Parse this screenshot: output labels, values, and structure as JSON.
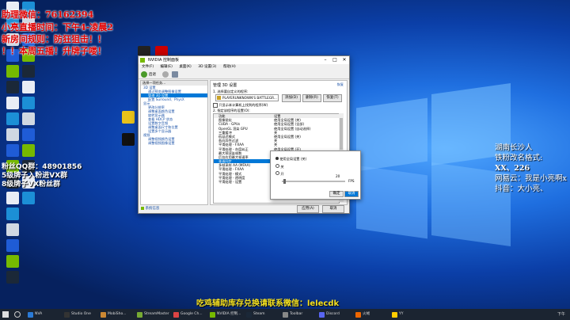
{
  "overlay": {
    "left_red_lines": [
      "助理微信：76162394",
      "小亮直播时间：下午4-凌晨2",
      "新房间规则：防狂狙击！！",
      "！！本周五播！升牌子喽！"
    ],
    "left_white_lines": [
      "粉丝QQ群：48901856",
      "5级牌子入粉进VX群",
      "8级牌子VX粉丝群"
    ],
    "right_lines": [
      "湖南长沙人",
      "铁粉改名格式:",
      "XX、226",
      "网易云：我是小亮啊x",
      "抖音：大小亮、"
    ],
    "bottom_yellow": "吃鸡辅助库存兑换请联系微信：lelecdk"
  },
  "window": {
    "title": "NVIDIA 控制面板",
    "menu": [
      "文件(F)",
      "编辑(E)",
      "桌面(K)",
      "3D 设置(3)",
      "帮助(H)"
    ],
    "left_header": "选择一项任务...",
    "tree": [
      {
        "label": "3D 设置",
        "level": 0,
        "selected": false
      },
      {
        "label": "通过预览调整图像设置",
        "level": 1,
        "selected": false
      },
      {
        "label": "管理 3D 设置",
        "level": 1,
        "selected": true
      },
      {
        "label": "配置 Surround、PhysX",
        "level": 1,
        "selected": false
      },
      {
        "label": "显示",
        "level": 0,
        "selected": false
      },
      {
        "label": "更改分辨率",
        "level": 1,
        "selected": false
      },
      {
        "label": "调整桌面颜色设置",
        "level": 1,
        "selected": false
      },
      {
        "label": "旋转显示器",
        "level": 1,
        "selected": false
      },
      {
        "label": "查看 HDCP 状态",
        "level": 1,
        "selected": false
      },
      {
        "label": "设置数字音频",
        "level": 1,
        "selected": false
      },
      {
        "label": "调整桌面尺寸和位置",
        "level": 1,
        "selected": false
      },
      {
        "label": "设置多个显示器",
        "level": 1,
        "selected": false
      },
      {
        "label": "视频",
        "level": 0,
        "selected": false
      },
      {
        "label": "调整视频颜色设置",
        "level": 1,
        "selected": false
      },
      {
        "label": "调整视频图像设置",
        "level": 1,
        "selected": false
      }
    ],
    "right_title": "管理 3D 设置",
    "restore_label": "恢复",
    "section1": "1. 选择要自定义的程序:",
    "program_value": "PLAYERUNKNOWN'S BATTLEGR...",
    "add_btn": "添加(D)",
    "remove_btn": "删除(R)",
    "restore_btn": "恢复(T)",
    "checkbox_label": "只显示本计算机上找到的程序(W)",
    "section2": "2. 指定该程序的设置(O):",
    "col_feature": "功能",
    "col_setting": "设置",
    "settings": [
      {
        "feature": "图像锐化",
        "value": "使用全局设置 (关)"
      },
      {
        "feature": "CUDA - GPUs",
        "value": "使用全局设置 (全部)"
      },
      {
        "feature": "OpenGL 渲染 GPU",
        "value": "使用全局设置 (自动选择)"
      },
      {
        "feature": "三重缓冲",
        "value": "关"
      },
      {
        "feature": "低延迟模式",
        "value": "使用全局设置 (关)"
      },
      {
        "feature": "各向异性过滤",
        "value": "关"
      },
      {
        "feature": "平滑处理 - FXAA",
        "value": "关"
      },
      {
        "feature": "平滑处理 - 灰度纠正",
        "value": "使用全局设置 (开)"
      },
      {
        "feature": "最大预渲染帧数",
        "value": "使用全局设置 (开)"
      },
      {
        "feature": "后台应用最大帧速率",
        "value": "使用全局设置 (关)"
      },
      {
        "feature": "垂直同步",
        "value": "使用全局设置 (关)"
      },
      {
        "feature": "多帧采样 AA (MFAA)",
        "value": "使用全局设置 (关)"
      },
      {
        "feature": "平滑处理 - FXAA",
        "value": "关"
      },
      {
        "feature": "平滑处理 - 模式",
        "value": "使用全局设置 (应用程序控制)"
      },
      {
        "feature": "平滑处理 - 透明度",
        "value": "使用全局设置 (关)"
      },
      {
        "feature": "平滑处理 - 设置",
        "value": "使用全局设置 (应用程序控制)"
      }
    ],
    "selected_row": 10,
    "sysinfo": "系统信息",
    "apply_btn": "应用(A)",
    "cancel_btn": "取消"
  },
  "popup": {
    "option1": "使用全局设置 (关)",
    "option2": "关",
    "option3": "开",
    "slider_value": "20",
    "unit": "FPS",
    "ok": "确定",
    "cancel": "取消"
  },
  "desktop_icons": [
    {
      "label": "此电脑",
      "color": "#e9edf5"
    },
    {
      "label": "Microsoft Edge",
      "color": "#1c8fd6"
    },
    {
      "label": "回收站",
      "color": "#d0d8e2"
    },
    {
      "label": "WPS",
      "color": "#1f5cd6"
    },
    {
      "label": "GeForce",
      "color": "#76b900"
    },
    {
      "label": "Steam",
      "color": "#1b2838"
    }
  ],
  "taskbar": {
    "tasks": [
      "NVA",
      "Studio One",
      "MobiSho...",
      "StreamMaster",
      "Google Ch...",
      "NVIDIA 控制...",
      "Steam",
      "Toolbar",
      "Discord",
      "火绒",
      "YY"
    ],
    "time": "下午"
  },
  "colors": {
    "red_text": "#e00000",
    "yellow_text": "#f4e021",
    "accent": "#0078d7",
    "nvidia": "#76b900"
  }
}
